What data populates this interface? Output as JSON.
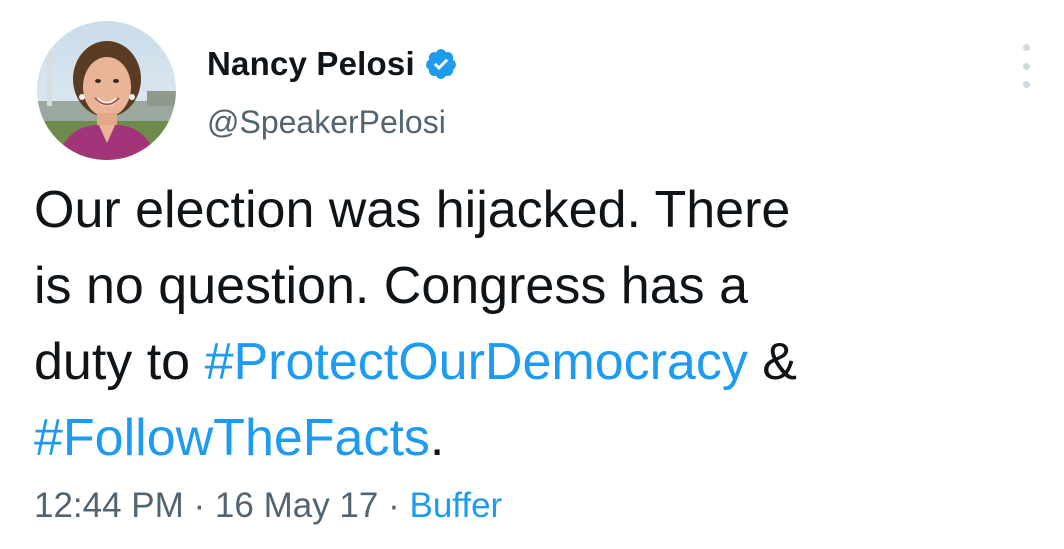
{
  "author": {
    "display_name": "Nancy Pelosi",
    "handle": "@SpeakerPelosi",
    "verified": true
  },
  "tweet": {
    "line1": "Our election was hijacked. There",
    "line2": "is no question. Congress has a",
    "line3_prefix": "duty to ",
    "hashtag1": "#ProtectOurDemocracy",
    "line3_suffix": " &",
    "hashtag2": "#FollowTheFacts",
    "line4_suffix": "."
  },
  "meta": {
    "time": "12:44 PM",
    "separator": " · ",
    "date": "16 May 17",
    "source": "Buffer"
  },
  "icons": {
    "verified": "verified-badge-icon",
    "more": "more-options-icon"
  },
  "colors": {
    "accent": "#1d9bf0",
    "text": "#0f1419",
    "secondary": "#536471"
  }
}
